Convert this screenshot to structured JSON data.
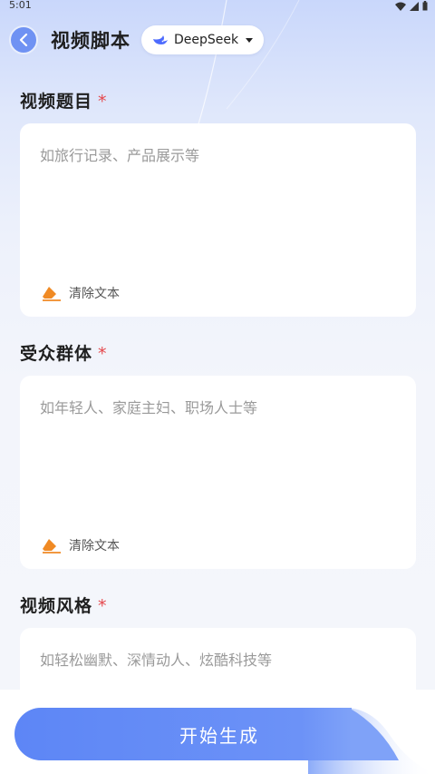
{
  "status_bar": {
    "time": "5:01"
  },
  "header": {
    "title": "视频脚本",
    "model_selector": {
      "selected": "DeepSeek"
    }
  },
  "form": {
    "required_mark": "*",
    "clear_label": "清除文本",
    "fields": [
      {
        "label": "视频题目",
        "placeholder": "如旅行记录、产品展示等",
        "value": ""
      },
      {
        "label": "受众群体",
        "placeholder": "如年轻人、家庭主妇、职场人士等",
        "value": ""
      },
      {
        "label": "视频风格",
        "placeholder": "如轻松幽默、深情动人、炫酷科技等",
        "value": ""
      }
    ]
  },
  "footer": {
    "start_button_label": "开始生成"
  },
  "colors": {
    "accent": "#5d86f6",
    "required": "#e5484d",
    "eraser": "#f08a24"
  }
}
